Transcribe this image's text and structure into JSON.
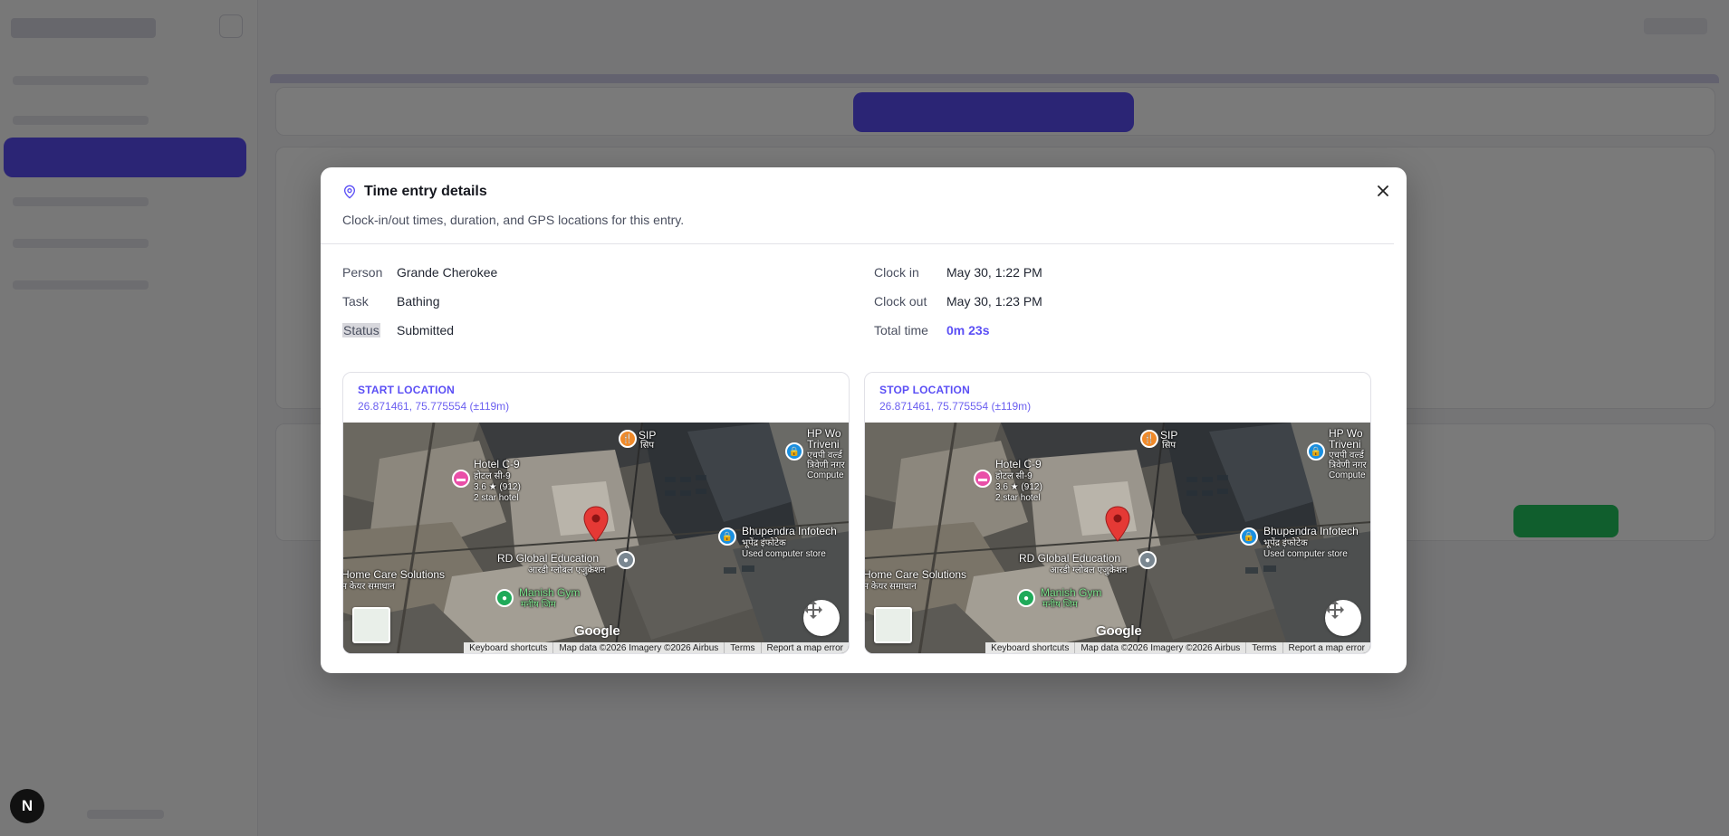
{
  "background": {
    "sidebar_logo_text": "N"
  },
  "modal": {
    "title": "Time entry details",
    "subtitle": "Clock-in/out times, duration, and GPS locations for this entry.",
    "close_icon": "close-icon",
    "details": {
      "person_label": "Person",
      "person_value": "Grande Cherokee",
      "task_label": "Task",
      "task_value": "Bathing",
      "status_label": "Status",
      "status_value": "Submitted",
      "clock_in_label": "Clock in",
      "clock_in_value": "May 30, 1:22 PM",
      "clock_out_label": "Clock out",
      "clock_out_value": "May 30, 1:23 PM",
      "total_label": "Total time",
      "total_value": "0m 23s"
    },
    "start_location": {
      "title": "START LOCATION",
      "coords": "26.871461, 75.775554 (±119m)"
    },
    "stop_location": {
      "title": "STOP LOCATION",
      "coords": "26.871461, 75.775554 (±119m)"
    },
    "map": {
      "labels": {
        "sip": "SIP",
        "sip_hi": "सिप",
        "hotel": "Hotel C-9",
        "hotel_hi": "होटल सी-9",
        "hotel_rating": "3.6 ★ (912)",
        "hotel_type": "2 star hotel",
        "hp": "HP Wo",
        "triveni": "Triveni",
        "hp_hi1": "एचपी वर्ल्ड",
        "hp_hi2": "त्रिवेणी नगर",
        "hp_compute": "Compute",
        "bhupendra": "Bhupendra Infotech",
        "bhupendra_hi": "भूपेंद्र इंफोटेक",
        "bhupendra_type": "Used computer store",
        "rd": "RD Global Education",
        "rd_hi": "आरडी ग्लोबल एजुकेशन",
        "home_care": "Home Care Solutions",
        "home_care_hi": "म केयर समाधान",
        "manish": "Manish Gym",
        "manish_hi": "मनीष जिम",
        "google": "Google"
      },
      "attribution": {
        "shortcuts": "Keyboard shortcuts",
        "data": "Map data ©2026 Imagery ©2026 Airbus",
        "terms": "Terms",
        "report": "Report a map error"
      }
    }
  }
}
